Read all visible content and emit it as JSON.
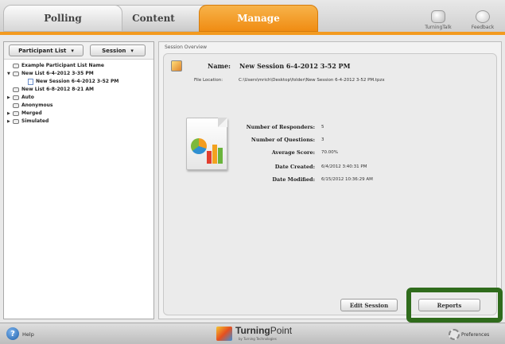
{
  "tabs": [
    {
      "label": "Polling"
    },
    {
      "label": "Content"
    },
    {
      "label": "Manage"
    }
  ],
  "top_icons": {
    "turningtalk": "TurningTalk",
    "feedback": "Feedback"
  },
  "left_panel": {
    "participant_dropdown": "Participant List",
    "session_dropdown": "Session",
    "tree": [
      "Example Participant List Name",
      "New List 6-4-2012 3-35 PM",
      "New Session 6-4-2012 3-52 PM",
      "New List 6-8-2012 8-21 AM",
      "Auto",
      "Anonymous",
      "Merged",
      "Simulated"
    ]
  },
  "main": {
    "section_title": "Session Overview",
    "name_label": "Name:",
    "name_value": "New Session 6-4-2012 3-52 PM",
    "file_location_label": "File Location:",
    "file_location_value": "C:\\Users\\mrich\\Desktop\\folder\\New Session 6-4-2012 3-52 PM.tpzx",
    "stats": [
      {
        "label": "Number of Responders:",
        "value": "5"
      },
      {
        "label": "Number of Questions:",
        "value": "3"
      },
      {
        "label": "Average Score:",
        "value": "70.00%"
      },
      {
        "label": "Date Created:",
        "value": "6/4/2012 3:40:31 PM"
      },
      {
        "label": "Date Modified:",
        "value": "6/15/2012 10:36:29 AM"
      }
    ],
    "edit_session_button": "Edit Session",
    "reports_button": "Reports"
  },
  "bottom": {
    "help": "Help",
    "brand_bold": "Turning",
    "brand_light": "Point",
    "brand_sub": "by Turning Technologies",
    "preferences": "Preferences"
  },
  "colors": {
    "accent_orange": "#f39a1f",
    "highlight_green": "#2f6b1c"
  }
}
